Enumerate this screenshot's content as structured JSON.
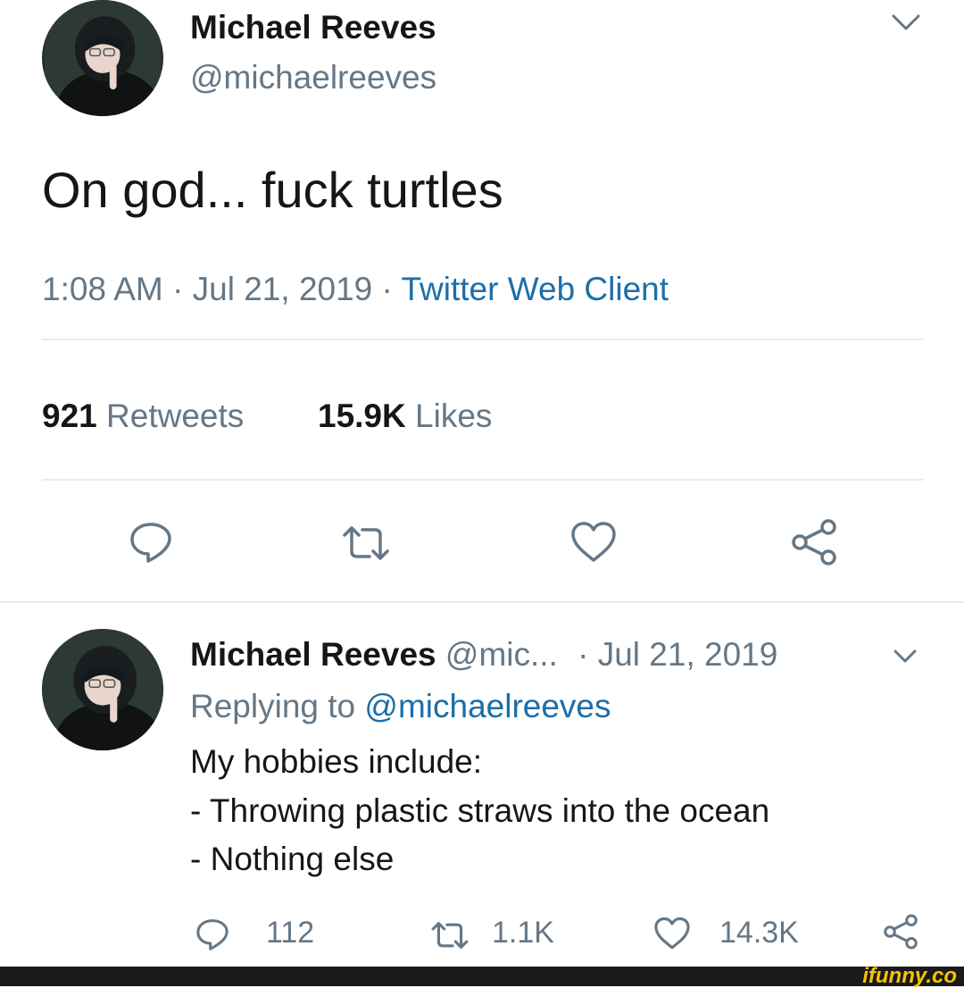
{
  "tweet": {
    "author_name": "Michael Reeves",
    "author_handle": "@michaelreeves",
    "text": "On god... fuck turtles",
    "time": "1:08 AM",
    "sep1": "·",
    "date": "Jul 21, 2019",
    "sep2": "·",
    "client": "Twitter Web Client",
    "retweets_count": "921",
    "retweets_label": "Retweets",
    "likes_count": "15.9K",
    "likes_label": "Likes",
    "actions": [
      "reply-icon",
      "retweet-icon",
      "like-icon",
      "share-icon"
    ]
  },
  "reply": {
    "author_name": "Michael Reeves",
    "author_handle": "@mic...",
    "date": "· Jul 21, 2019",
    "replying_prefix": "Replying to",
    "replying_handle": "@michaelreeves",
    "lines": [
      "My hobbies include:",
      "- Throwing plastic straws into the ocean",
      "- Nothing else"
    ],
    "reply_count": "112",
    "retweet_count": "1.1K",
    "like_count": "14.3K"
  },
  "watermark": {
    "text": "ifunny.co",
    "color": "#f5c400",
    "bar_color": "#1a1a1a"
  },
  "colors": {
    "link": "#1b6fa8",
    "muted": "#657786",
    "text": "#14171a"
  }
}
